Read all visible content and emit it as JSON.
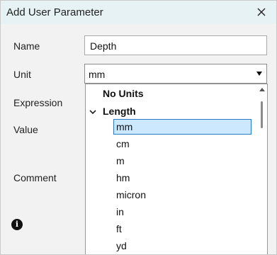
{
  "dialog": {
    "title": "Add User Parameter",
    "close_icon": "close-icon"
  },
  "form": {
    "name_label": "Name",
    "name_value": "Depth",
    "unit_label": "Unit",
    "unit_value": "mm",
    "expression_label": "Expression",
    "value_label": "Value",
    "comment_label": "Comment",
    "info_icon": "info-icon"
  },
  "unit_dropdown": {
    "no_units": "No Units",
    "group": "Length",
    "items": [
      "mm",
      "cm",
      "m",
      "hm",
      "micron",
      "in",
      "ft",
      "yd"
    ],
    "selected": "mm"
  },
  "colors": {
    "titlebar": "#e6f2f4",
    "selection_fill": "#cce8ff",
    "selection_border": "#2b78c4"
  }
}
